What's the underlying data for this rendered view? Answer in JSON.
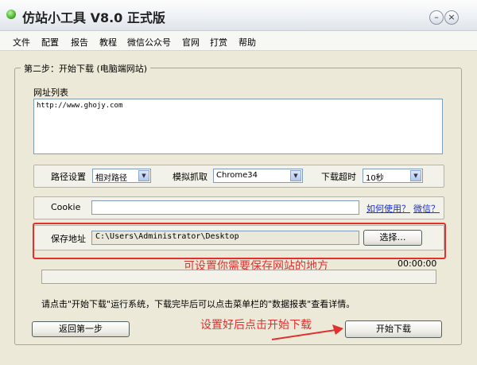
{
  "window": {
    "title": "仿站小工具 V8.0 正式版"
  },
  "menu": [
    "文件",
    "配置",
    "报告",
    "教程",
    "微信公众号",
    "官网",
    "打赏",
    "帮助"
  ],
  "step": {
    "title": "第二步：开始下载 (电脑端网站)"
  },
  "url_list": {
    "label": "网址列表",
    "value": "http://www.ghojy.com"
  },
  "options": {
    "path_label": "路径设置",
    "path_value": "相对路径",
    "mode_label": "模拟抓取",
    "mode_value": "Chrome34",
    "timeout_label": "下载超时",
    "timeout_value": "10秒"
  },
  "cookie": {
    "label": "Cookie",
    "value": "",
    "help_link": "如何使用？",
    "wechat_link": "微信？"
  },
  "save": {
    "label": "保存地址",
    "value": "C:\\Users\\Administrator\\Desktop",
    "choose_button": "选择…"
  },
  "annotations": {
    "save_hint": "可设置你需要保存网站的地方",
    "start_hint": "设置好后点击开始下载"
  },
  "progress": {
    "time": "00:00:00",
    "fraction": 0
  },
  "tip": "请点击\"开始下载\"运行系统，下载完毕后可以点击菜单栏的\"数据报表\"查看详情。",
  "buttons": {
    "back": "返回第一步",
    "start": "开始下载"
  },
  "colors": {
    "annotation": "#e03030",
    "link": "#1b2fd4",
    "background": "#ece9d8"
  },
  "icons": {
    "app": "green-circle-icon",
    "minimize": "minimize-icon",
    "close": "close-icon",
    "dropdown": "chevron-down-icon",
    "arrow": "red-arrow-icon"
  }
}
